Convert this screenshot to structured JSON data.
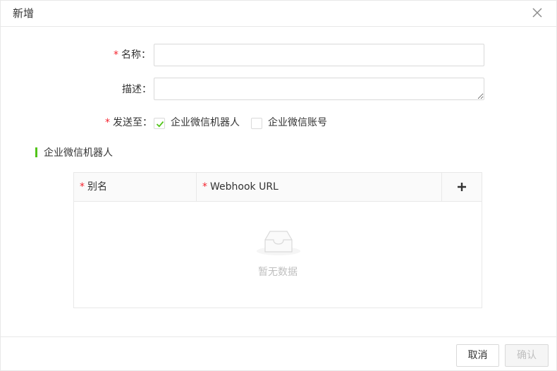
{
  "dialog": {
    "title": "新增",
    "close_icon": "close-icon"
  },
  "form": {
    "name": {
      "required_mark": "*",
      "label": "名称：",
      "value": "",
      "placeholder": ""
    },
    "description": {
      "label": "描述：",
      "value": "",
      "placeholder": ""
    },
    "send_to": {
      "required_mark": "*",
      "label": "发送至：",
      "options": [
        {
          "label": "企业微信机器人",
          "checked": true
        },
        {
          "label": "企业微信账号",
          "checked": false
        }
      ]
    }
  },
  "section": {
    "title": "企业微信机器人",
    "accent_color": "#52c41a"
  },
  "table": {
    "columns": [
      {
        "required_mark": "*",
        "label": "别名"
      },
      {
        "required_mark": "*",
        "label": "Webhook URL"
      }
    ],
    "add_icon": "plus-icon",
    "empty_icon": "inbox-icon",
    "empty_text": "暂无数据"
  },
  "footer": {
    "cancel_label": "取消",
    "ok_label": "确认"
  },
  "colors": {
    "required": "#f5222d",
    "check": "#52c41a",
    "border": "#d9d9d9"
  }
}
